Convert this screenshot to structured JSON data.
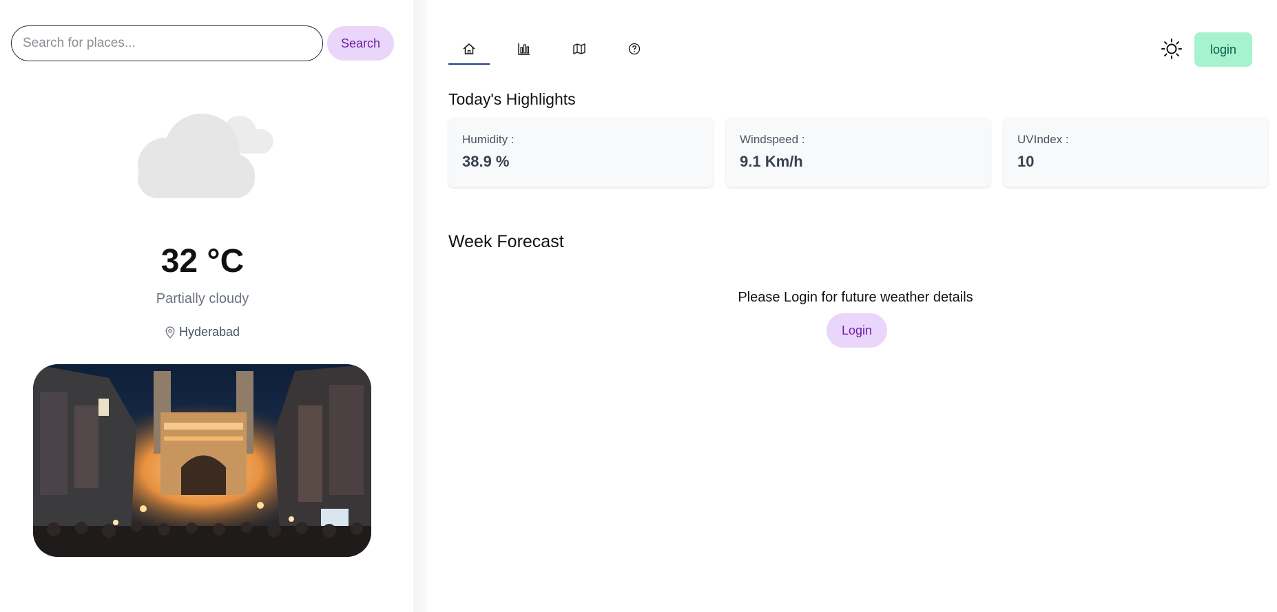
{
  "search": {
    "placeholder": "Search for places...",
    "button_label": "Search"
  },
  "weather": {
    "icon": "cloud-icon",
    "temperature": "32 °C",
    "condition": "Partially cloudy",
    "location": "Hyderabad"
  },
  "nav": {
    "tabs": [
      {
        "icon": "home-icon",
        "active": true
      },
      {
        "icon": "chart-icon",
        "active": false
      },
      {
        "icon": "map-icon",
        "active": false
      },
      {
        "icon": "help-icon",
        "active": false
      }
    ],
    "theme_icon": "sun-icon",
    "login_label": "login"
  },
  "highlights": {
    "title": "Today's Highlights",
    "cards": [
      {
        "label": "Humidity :",
        "value": "38.9 %"
      },
      {
        "label": "Windspeed :",
        "value": "9.1 Km/h"
      },
      {
        "label": "UVIndex :",
        "value": "10"
      }
    ]
  },
  "forecast": {
    "title": "Week Forecast",
    "message": "Please Login for future weather details",
    "login_label": "Login"
  },
  "colors": {
    "accent_purple_bg": "#ead5fb",
    "accent_purple_text": "#6b21a8",
    "login_green_bg": "#a7f3d0",
    "tab_indicator": "#1e3a8a"
  }
}
